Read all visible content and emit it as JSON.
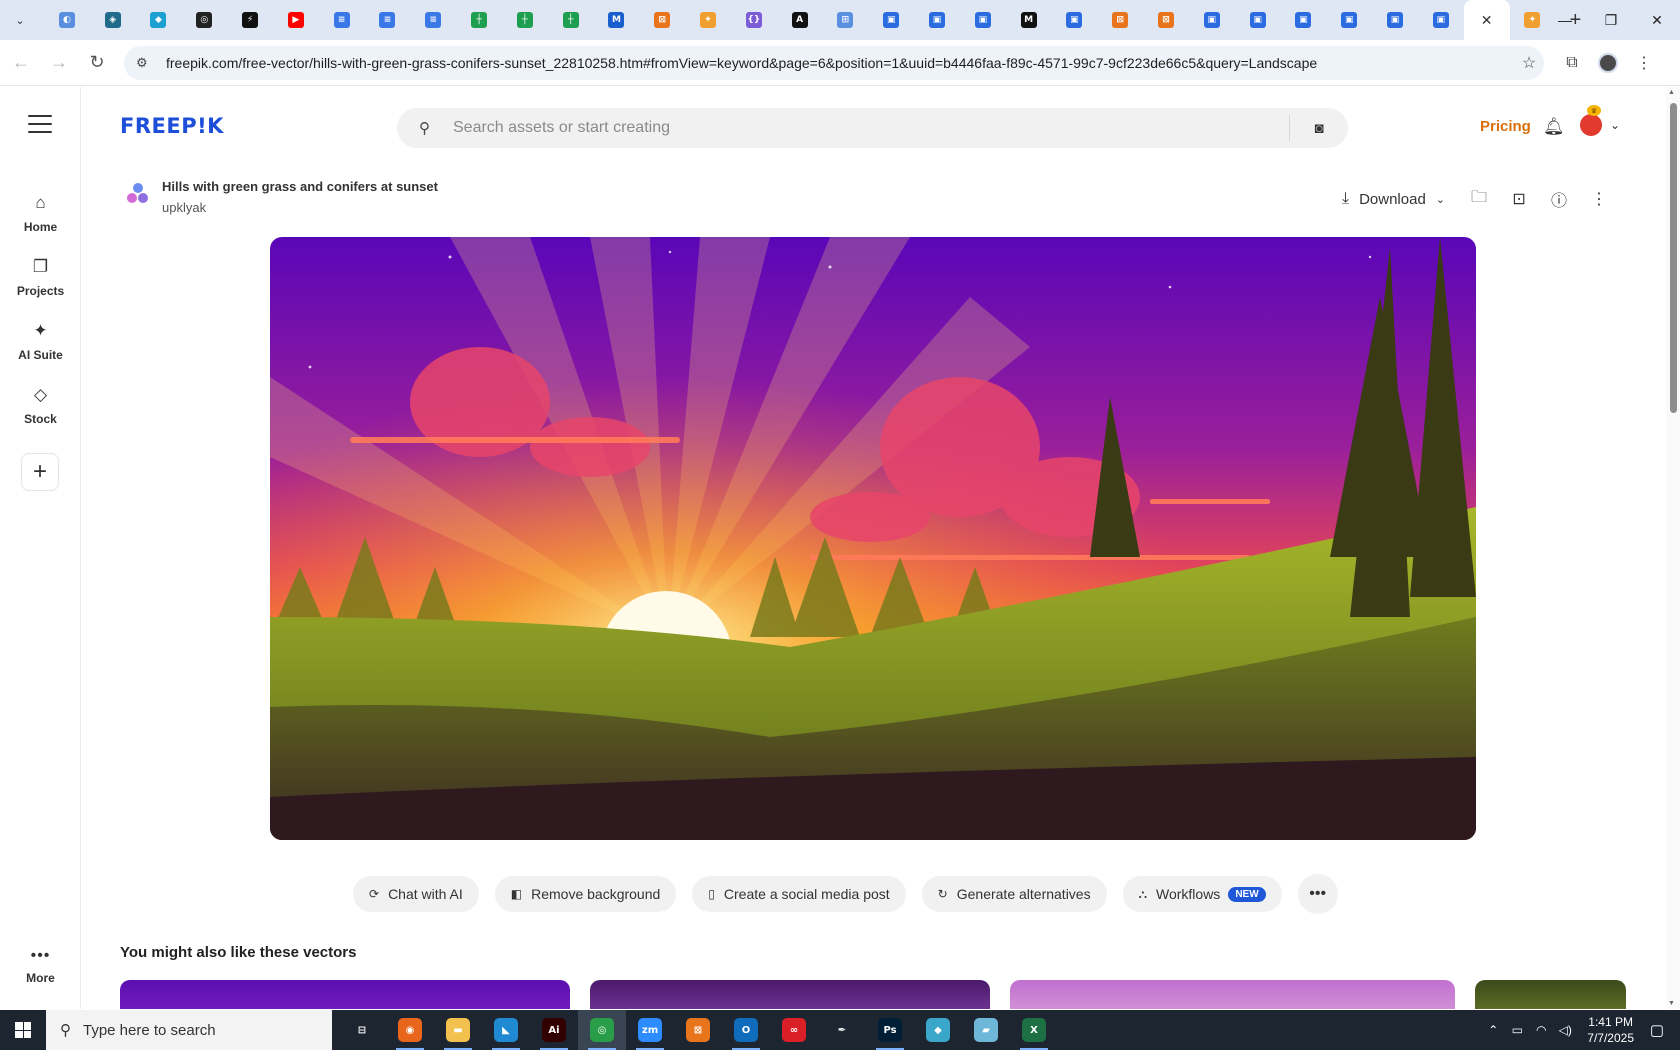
{
  "browser": {
    "new_tab_label": "+",
    "active_tab_close": "✕",
    "pinned_tabs": [
      {
        "icon": "app-icon",
        "color": "#5a8fe0",
        "glyph": "◐"
      },
      {
        "icon": "app-icon",
        "color": "#1f6b8a",
        "glyph": "◈"
      },
      {
        "icon": "app-icon",
        "color": "#1c9fd1",
        "glyph": "◆"
      },
      {
        "icon": "app-icon",
        "color": "#222222",
        "glyph": "◎"
      },
      {
        "icon": "app-icon",
        "color": "#111111",
        "glyph": "⚡"
      },
      {
        "icon": "youtube-icon",
        "color": "#ff0000",
        "glyph": "▶"
      },
      {
        "icon": "docs-icon",
        "color": "#3b78e7",
        "glyph": "≡"
      },
      {
        "icon": "docs-icon",
        "color": "#3b78e7",
        "glyph": "≡"
      },
      {
        "icon": "docs-icon",
        "color": "#3b78e7",
        "glyph": "≡"
      },
      {
        "icon": "sheets-icon",
        "color": "#1e9e4f",
        "glyph": "┼"
      },
      {
        "icon": "sheets-icon",
        "color": "#1e9e4f",
        "glyph": "┼"
      },
      {
        "icon": "sheets-icon",
        "color": "#1e9e4f",
        "glyph": "┼"
      },
      {
        "icon": "app-icon",
        "color": "#1a5fcf",
        "glyph": "M"
      },
      {
        "icon": "app-icon",
        "color": "#e8741c",
        "glyph": "⊠"
      },
      {
        "icon": "app-icon",
        "color": "#f0a030",
        "glyph": "✦"
      },
      {
        "icon": "app-icon",
        "color": "#7b5cd6",
        "glyph": "{}"
      },
      {
        "icon": "app-icon",
        "color": "#111111",
        "glyph": "A"
      },
      {
        "icon": "app-icon",
        "color": "#5b8fe0",
        "glyph": "⊞"
      },
      {
        "icon": "forms-icon",
        "color": "#2b6de0",
        "glyph": "▣"
      },
      {
        "icon": "forms-icon",
        "color": "#2b6de0",
        "glyph": "▣"
      },
      {
        "icon": "forms-icon",
        "color": "#2b6de0",
        "glyph": "▣"
      },
      {
        "icon": "app-icon",
        "color": "#111111",
        "glyph": "M"
      },
      {
        "icon": "forms-icon",
        "color": "#2b6de0",
        "glyph": "▣"
      },
      {
        "icon": "app-icon",
        "color": "#e8741c",
        "glyph": "⊠"
      },
      {
        "icon": "app-icon",
        "color": "#e8741c",
        "glyph": "⊠"
      },
      {
        "icon": "forms-icon",
        "color": "#2b6de0",
        "glyph": "▣"
      },
      {
        "icon": "forms-icon",
        "color": "#2b6de0",
        "glyph": "▣"
      },
      {
        "icon": "forms-icon",
        "color": "#2b6de0",
        "glyph": "▣"
      },
      {
        "icon": "forms-icon",
        "color": "#2b6de0",
        "glyph": "▣"
      },
      {
        "icon": "forms-icon",
        "color": "#2b6de0",
        "glyph": "▣"
      },
      {
        "icon": "forms-icon",
        "color": "#2b6de0",
        "glyph": "▣"
      }
    ],
    "url": "freepik.com/free-vector/hills-with-green-grass-conifers-sunset_22810258.htm#fromView=keyword&page=6&position=1&uuid=b4446faa-f89c-4571-99c7-9cf223de66c5&query=Landscape"
  },
  "sidebar": {
    "items": [
      {
        "label": "Home",
        "icon": "home-icon"
      },
      {
        "label": "Projects",
        "icon": "projects-icon"
      },
      {
        "label": "AI Suite",
        "icon": "sparkles-icon"
      },
      {
        "label": "Stock",
        "icon": "shapes-icon"
      }
    ],
    "more_label": "More"
  },
  "header": {
    "logo": "FREEP!K",
    "search_placeholder": "Search assets or start creating",
    "pricing": "Pricing"
  },
  "asset": {
    "title": "Hills with green grass and conifers at sunset",
    "author": "upklyak",
    "download_label": "Download"
  },
  "ai_actions": [
    {
      "label": "Chat with AI",
      "icon": "chat-icon"
    },
    {
      "label": "Remove background",
      "icon": "remove-bg-icon"
    },
    {
      "label": "Create a social media post",
      "icon": "phone-icon"
    },
    {
      "label": "Generate alternatives",
      "icon": "refresh-icon"
    },
    {
      "label": "Workflows",
      "icon": "workflow-icon",
      "badge": "NEW"
    }
  ],
  "related": {
    "title": "You might also like these vectors"
  },
  "taskbar": {
    "search_text": "Type here to search",
    "time": "1:41 PM",
    "date": "7/7/2025",
    "apps": [
      {
        "icon": "task-view-icon",
        "color": "#1d2530",
        "glyph": "⊟"
      },
      {
        "icon": "firefox-icon",
        "color": "#e8661c",
        "glyph": "◉"
      },
      {
        "icon": "file-explorer-icon",
        "color": "#f2c14e",
        "glyph": "▬"
      },
      {
        "icon": "vscode-icon",
        "color": "#1f8ad2",
        "glyph": "◣"
      },
      {
        "icon": "illustrator-icon",
        "color": "#330000",
        "glyph": "Ai"
      },
      {
        "icon": "chrome-icon",
        "color": "#2a9d49",
        "glyph": "◎"
      },
      {
        "icon": "zoom-icon",
        "color": "#2d8cff",
        "glyph": "zm"
      },
      {
        "icon": "app-icon",
        "color": "#e8741c",
        "glyph": "⊠"
      },
      {
        "icon": "outlook-icon",
        "color": "#0f6cbd",
        "glyph": "O"
      },
      {
        "icon": "creative-cloud-icon",
        "color": "#da1f26",
        "glyph": "∞"
      },
      {
        "icon": "pen-icon",
        "color": "#1d2530",
        "glyph": "✒"
      },
      {
        "icon": "photoshop-icon",
        "color": "#001e36",
        "glyph": "Ps"
      },
      {
        "icon": "app-icon",
        "color": "#3aa6c9",
        "glyph": "◆"
      },
      {
        "icon": "app-icon",
        "color": "#6fb7d8",
        "glyph": "▰"
      },
      {
        "icon": "excel-icon",
        "color": "#1d7044",
        "glyph": "X"
      }
    ]
  }
}
